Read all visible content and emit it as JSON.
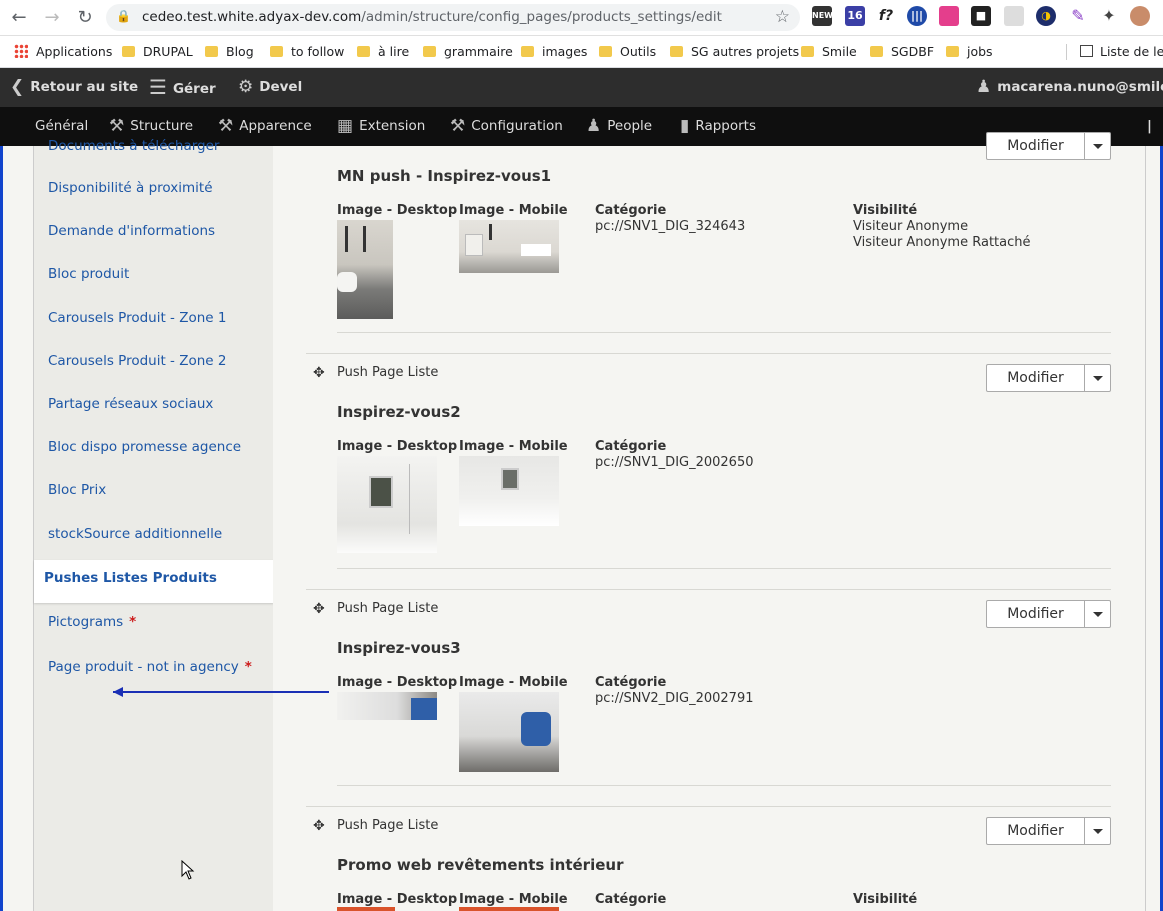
{
  "browser": {
    "url_host": "cedeo.test.white.adyax-dev.com",
    "url_path": "/admin/structure/config_pages/products_settings/edit",
    "bookmarks": [
      "Applications",
      "DRUPAL",
      "Blog",
      "to follow",
      "à lire",
      "grammaire",
      "images",
      "Outils",
      "SG autres projets",
      "Smile",
      "SGDBF",
      "jobs",
      "Liste de lec"
    ]
  },
  "toolbar": {
    "back": "Retour au site",
    "manage": "Gérer",
    "devel": "Devel",
    "user": "macarena.nuno@smile.fr"
  },
  "tray": [
    "Général",
    "Structure",
    "Apparence",
    "Extension",
    "Configuration",
    "People",
    "Rapports"
  ],
  "sidebar": {
    "tabs": [
      "Documents à télécharger",
      "Disponibilité à proximité",
      "Demande d'informations",
      "Bloc produit",
      "Carousels Produit - Zone 1",
      "Carousels Produit - Zone 2",
      "Partage réseaux sociaux",
      "Bloc dispo promesse agence",
      "Bloc Prix",
      "stockSource additionnelle"
    ],
    "active": "Pushes Listes Produits",
    "required_tabs": [
      "Pictograms",
      "Page produit - not in agency"
    ]
  },
  "labels": {
    "image_desktop": "Image - Desktop",
    "image_mobile": "Image - Mobile",
    "category": "Catégorie",
    "visibility": "Visibilité",
    "push_type": "Push Page Liste",
    "modify": "Modifier"
  },
  "items": [
    {
      "title": "MN push - Inspirez-vous1",
      "category": "pc://SNV1_DIG_324643",
      "visibility": [
        "Visiteur Anonyme",
        "Visiteur Anonyme Rattaché"
      ]
    },
    {
      "title": "Inspirez-vous2",
      "category": "pc://SNV1_DIG_2002650"
    },
    {
      "title": "Inspirez-vous3",
      "category": "pc://SNV2_DIG_2002791"
    },
    {
      "title": "Promo web revêtements intérieur"
    }
  ],
  "colors": {
    "toolbar": "#2d2d2d",
    "tray": "#0f0f0f",
    "link": "#1e57a6",
    "required": "#cc1b1b",
    "annotation": "#1a2fb5"
  }
}
